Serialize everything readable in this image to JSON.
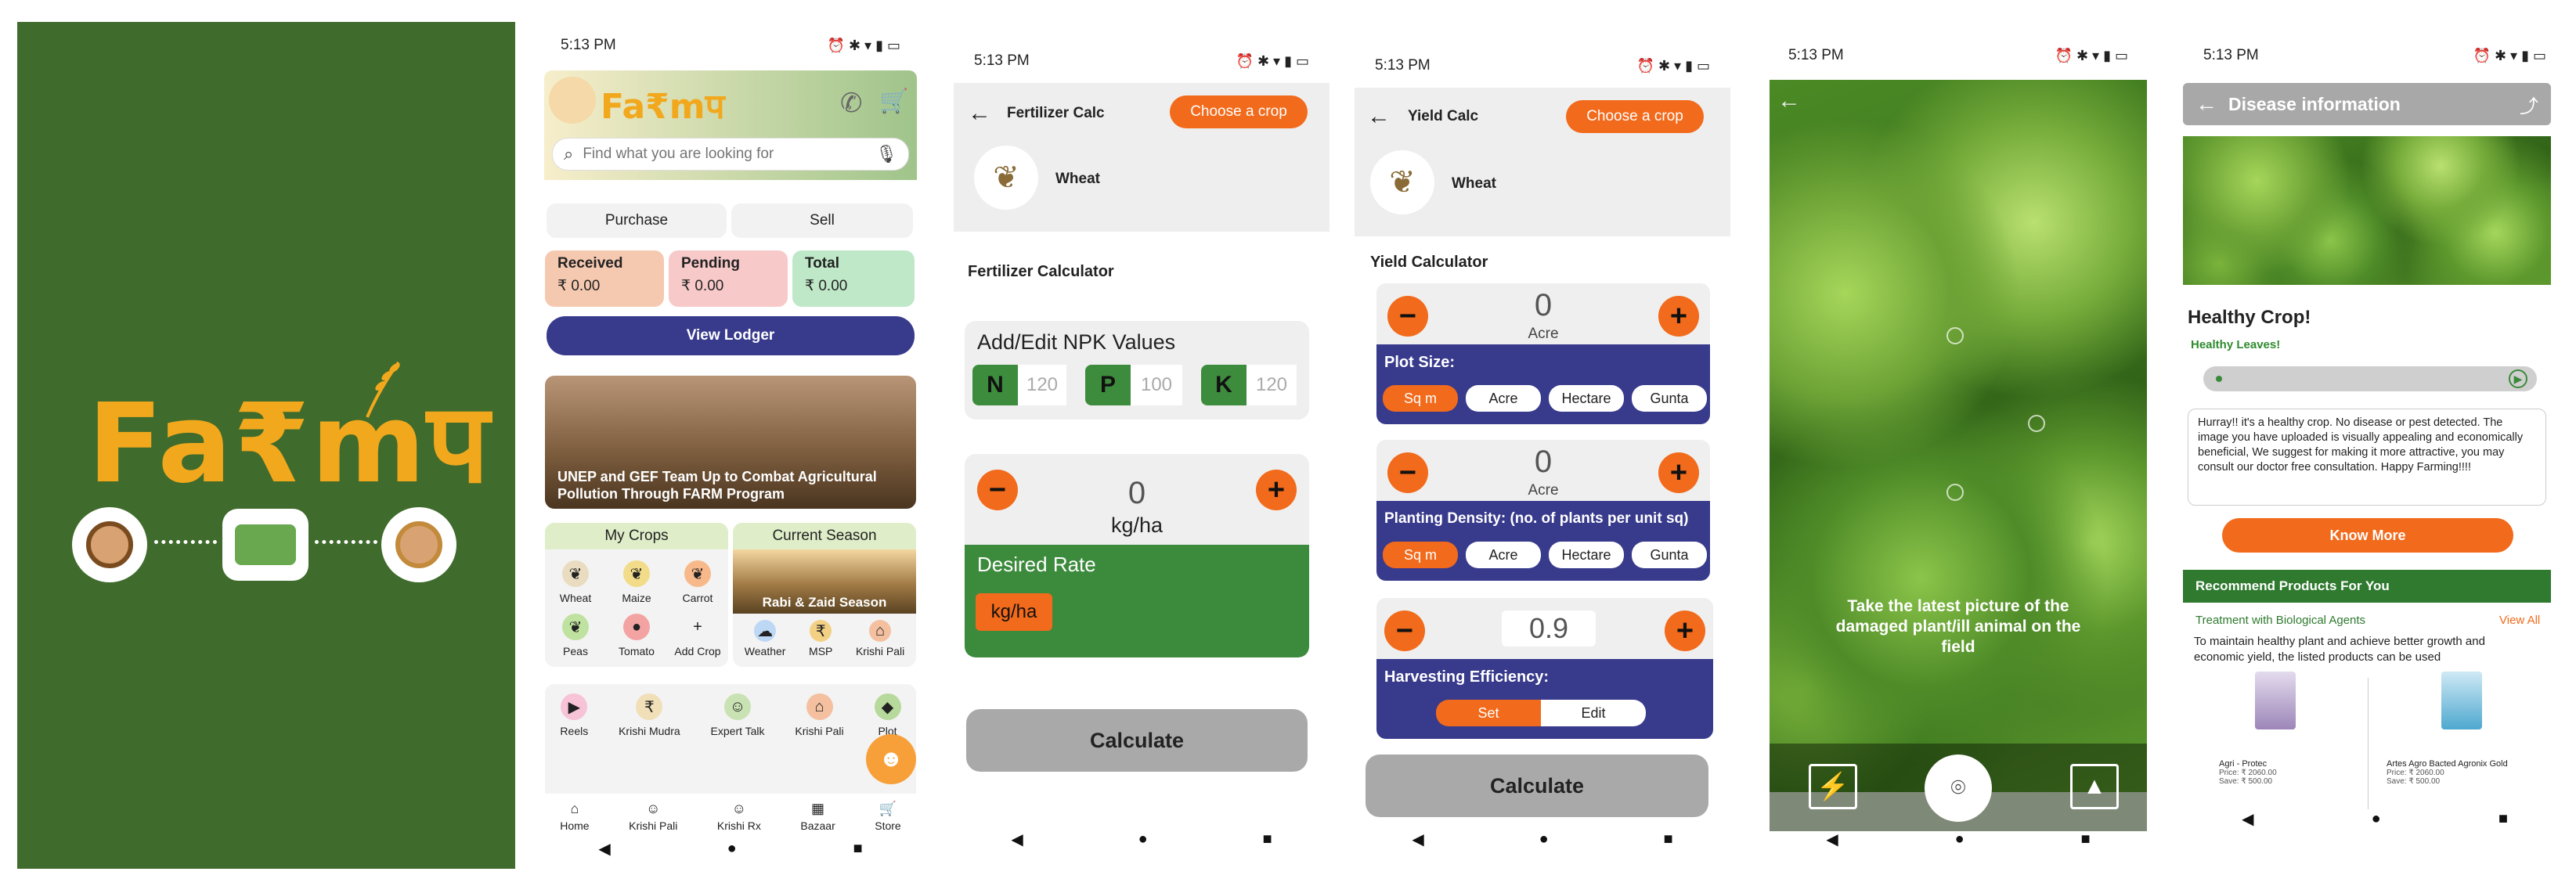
{
  "splash": {
    "logo": "Fa₹mप"
  },
  "home": {
    "time": "5:13 PM",
    "logo": "Fa₹mप",
    "search_placeholder": "Find what you are looking for",
    "tabs": [
      "Purchase",
      "Sell"
    ],
    "stats": [
      {
        "label": "Received",
        "value": "₹ 0.00",
        "color": "#f5c9b0"
      },
      {
        "label": "Pending",
        "value": "₹ 0.00",
        "color": "#f8c9c9"
      },
      {
        "label": "Total",
        "value": "₹ 0.00",
        "color": "#bfe8c8"
      }
    ],
    "view_ledger": "View Lodger",
    "news": "UNEP and GEF Team Up to Combat Agricultural Pollution Through FARM Program",
    "my_crops_title": "My Crops",
    "crops": [
      "Wheat",
      "Maize",
      "Carrot",
      "Peas",
      "Tomato",
      "Add Crop"
    ],
    "season_title": "Current Season",
    "season_name": "Rabi & Zaid Season",
    "season_items": [
      "Weather",
      "MSP",
      "Krishi Pali"
    ],
    "services": [
      "Reels",
      "Krishi Mudra",
      "Expert Talk",
      "Krishi Pali",
      "Plot"
    ],
    "bottom_nav": [
      "Home",
      "Krishi Pali",
      "Krishi Rx",
      "Bazaar",
      "Store"
    ]
  },
  "fert": {
    "time": "5:13 PM",
    "title": "Fertilizer Calc",
    "choose": "Choose a crop",
    "crop": "Wheat",
    "section": "Fertilizer Calculator",
    "npk_title": "Add/Edit NPK Values",
    "npk": [
      {
        "k": "N",
        "v": "120"
      },
      {
        "k": "P",
        "v": "100"
      },
      {
        "k": "K",
        "v": "120"
      }
    ],
    "value": "0",
    "unit": "kg/ha",
    "desired": "Desired Rate",
    "desired_unit": "kg/ha",
    "calc": "Calculate"
  },
  "yield": {
    "time": "5:13 PM",
    "title": "Yield Calc",
    "choose": "Choose a crop",
    "crop": "Wheat",
    "section": "Yield Calculator",
    "plot_value": "0",
    "plot_unit": "Acre",
    "plot_label": "Plot Size:",
    "units": [
      "Sq m",
      "Acre",
      "Hectare",
      "Gunta"
    ],
    "density_value": "0",
    "density_unit": "Acre",
    "density_label": "Planting Density: (no. of plants per unit sq)",
    "eff_value": "0.9",
    "eff_label": "Harvesting Efficiency:",
    "eff_opts": [
      "Set",
      "Edit"
    ],
    "calc": "Calculate"
  },
  "camera": {
    "time": "5:13 PM",
    "hint": "Take the latest picture of the damaged plant/ill animal on the field"
  },
  "disease": {
    "time": "5:13 PM",
    "title": "Disease information",
    "heading": "Healthy Crop!",
    "sub": "Healthy Leaves!",
    "message": "Hurray!! it's a healthy crop. No disease or pest detected. The image you have uploaded is visually appealing and economically beneficial, We suggest for making it more attractive, you may consult our doctor free consultation. Happy Farming!!!!",
    "know_more": "Know More",
    "recommend": "Recommend Products For You",
    "bio": "Treatment with Biological Agents",
    "view_all": "View All",
    "desc": "To maintain healthy plant and achieve better growth and economic yield, the listed products can be used",
    "products": [
      {
        "name": "Agri - Protec",
        "price": "Price: ₹ 2060.00",
        "save": "Save: ₹ 500.00"
      },
      {
        "name": "Artes Agro Bacted Agronix Gold",
        "price": "Price: ₹ 2060.00",
        "save": "Save: ₹ 500.00"
      }
    ]
  }
}
